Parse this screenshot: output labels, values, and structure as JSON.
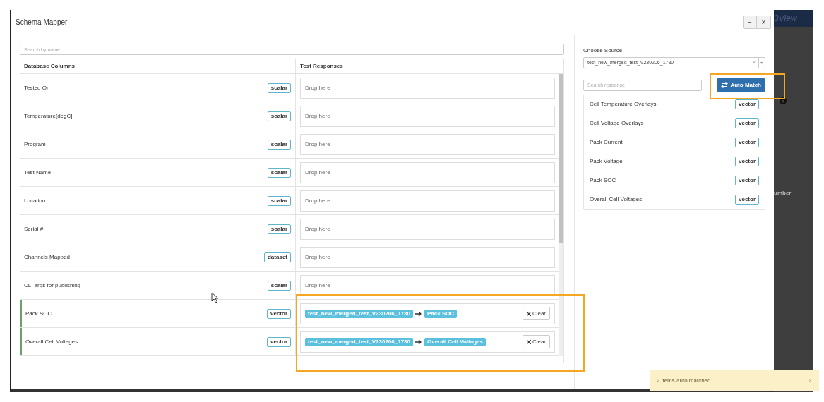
{
  "window": {
    "title": "Schema Mapper",
    "minimize": "−",
    "close": "×"
  },
  "left": {
    "search": {
      "placeholder": "Search by name"
    },
    "columns": [
      "Database Columns",
      "Test Responses"
    ],
    "rows": [
      {
        "name": "Tested On",
        "type": "scalar",
        "kind": "empty",
        "drop": "Drop here"
      },
      {
        "name": "Temperature[degC]",
        "type": "scalar",
        "kind": "empty",
        "drop": "Drop here"
      },
      {
        "name": "Program",
        "type": "scalar",
        "kind": "empty",
        "drop": "Drop here"
      },
      {
        "name": "Test Name",
        "type": "scalar",
        "kind": "empty",
        "drop": "Drop here"
      },
      {
        "name": "Location",
        "type": "scalar",
        "kind": "empty",
        "drop": "Drop here"
      },
      {
        "name": "Serial #",
        "type": "scalar",
        "kind": "empty",
        "drop": "Drop here"
      },
      {
        "name": "Channels Mapped",
        "type": "dataset",
        "kind": "empty",
        "drop": "Drop here"
      },
      {
        "name": "CLI args for publishing",
        "type": "scalar",
        "kind": "empty",
        "drop": "Drop here"
      },
      {
        "name": "Pack SOC",
        "type": "vector",
        "kind": "mapped",
        "source": "test_new_merged_test_V230206_1730",
        "target": "Pack SOC",
        "clear": "Clear"
      },
      {
        "name": "Overall Cell Voltages",
        "type": "vector",
        "kind": "mapped",
        "source": "test_new_merged_test_V230206_1730",
        "target": "Overall Cell Voltages",
        "clear": "Clear"
      }
    ]
  },
  "right": {
    "source_label": "Choose Source",
    "source_value": "test_new_merged_test_V230206_1730",
    "source_clear": "×",
    "search": {
      "placeholder": "Search response"
    },
    "auto_match": "Auto Match",
    "responses": [
      {
        "name": "Cell Temperature Overlays",
        "type": "vector"
      },
      {
        "name": "Cell Voltage Overlays",
        "type": "vector"
      },
      {
        "name": "Pack Current",
        "type": "vector"
      },
      {
        "name": "Pack Voltage",
        "type": "vector"
      },
      {
        "name": "Pack SOC",
        "type": "vector"
      },
      {
        "name": "Overall Cell Voltages",
        "type": "vector"
      }
    ]
  },
  "background": {
    "logo": "3View",
    "column_header": "umber"
  },
  "toast": {
    "text": "2 items auto matched",
    "close": "×"
  }
}
